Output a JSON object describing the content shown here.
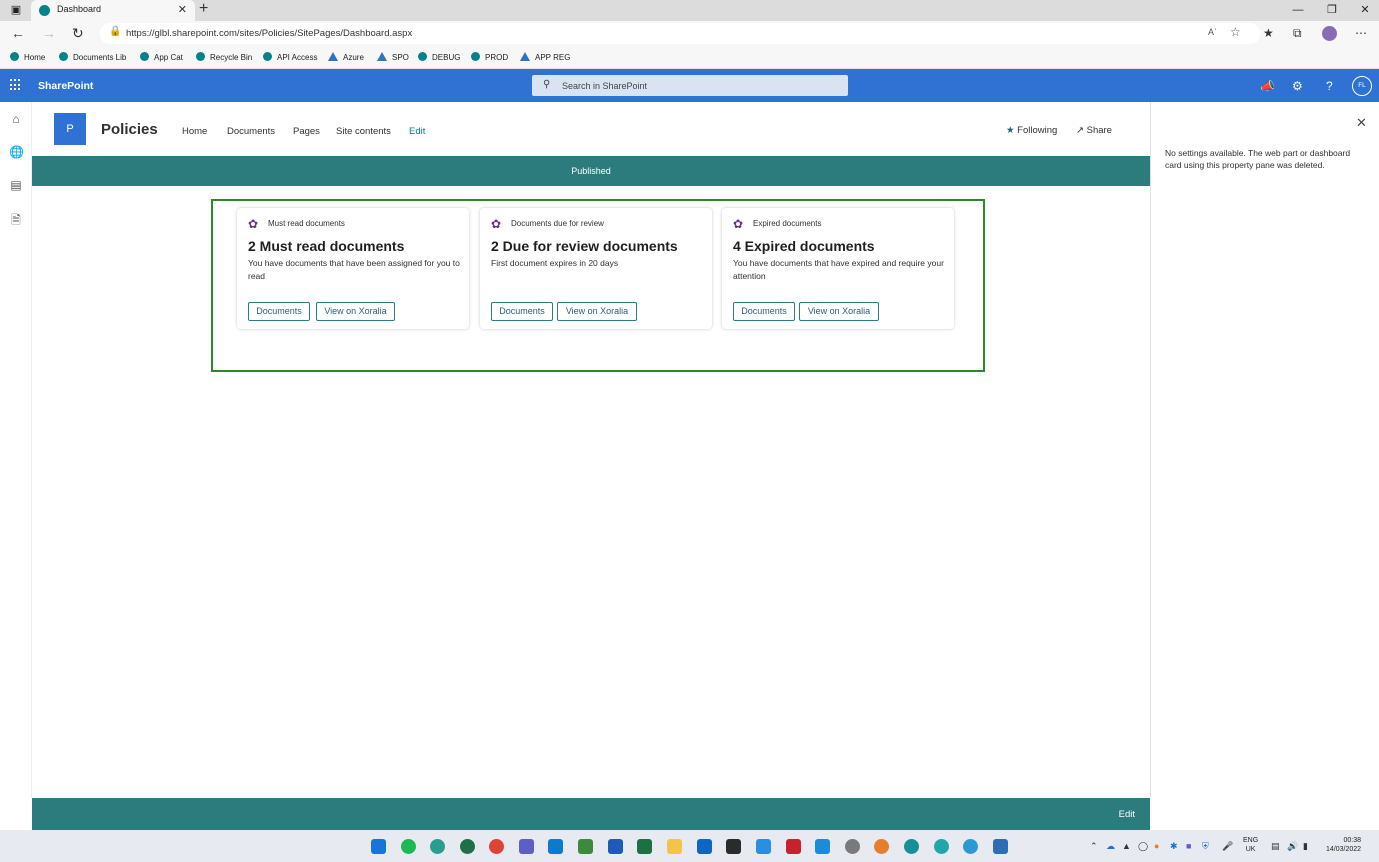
{
  "browser": {
    "tab_title": "Dashboard",
    "url": "https://glbl.sharepoint.com/sites/Policies/SitePages/Dashboard.aspx",
    "read_aloud": "Aʾ",
    "bookmarks": [
      "Home",
      "Documents Lib",
      "App Cat",
      "Recycle Bin",
      "API Access",
      "Azure",
      "SPO",
      "DEBUG",
      "PROD",
      "APP REG"
    ]
  },
  "suite": {
    "title": "SharePoint",
    "search_placeholder": "Search in SharePoint",
    "user_initials": "FL"
  },
  "site": {
    "logo_letter": "P",
    "title": "Policies",
    "nav": [
      "Home",
      "Documents",
      "Pages",
      "Site contents",
      "Edit"
    ],
    "following": "Following",
    "share": "Share",
    "status": "Published"
  },
  "cards": [
    {
      "small_title": "Must read documents",
      "big_title": "2 Must read documents",
      "description": "You have documents that have been assigned for you to read",
      "buttons": [
        "Documents",
        "View on Xoralia"
      ]
    },
    {
      "small_title": "Documents due for review",
      "big_title": "2 Due for review documents",
      "description": "First document expires in 20 days",
      "buttons": [
        "Documents",
        "View on Xoralia"
      ]
    },
    {
      "small_title": "Expired documents",
      "big_title": "4 Expired documents",
      "description": "You have documents that have expired and require your attention",
      "buttons": [
        "Documents",
        "View on Xoralia"
      ]
    }
  ],
  "property_pane": {
    "message": "No settings available. The web part or dashboard card using this property pane was deleted."
  },
  "bottom_bar": {
    "edit": "Edit"
  },
  "taskbar": {
    "lang": "ENG",
    "region": "UK",
    "time": "00:38",
    "date": "14/03/2022"
  },
  "colors": {
    "suite_blue": "#2f72d4",
    "teal": "#2c7b7d",
    "zone_green": "#2a8a2a",
    "card_icon_purple": "#6b2d8b"
  }
}
